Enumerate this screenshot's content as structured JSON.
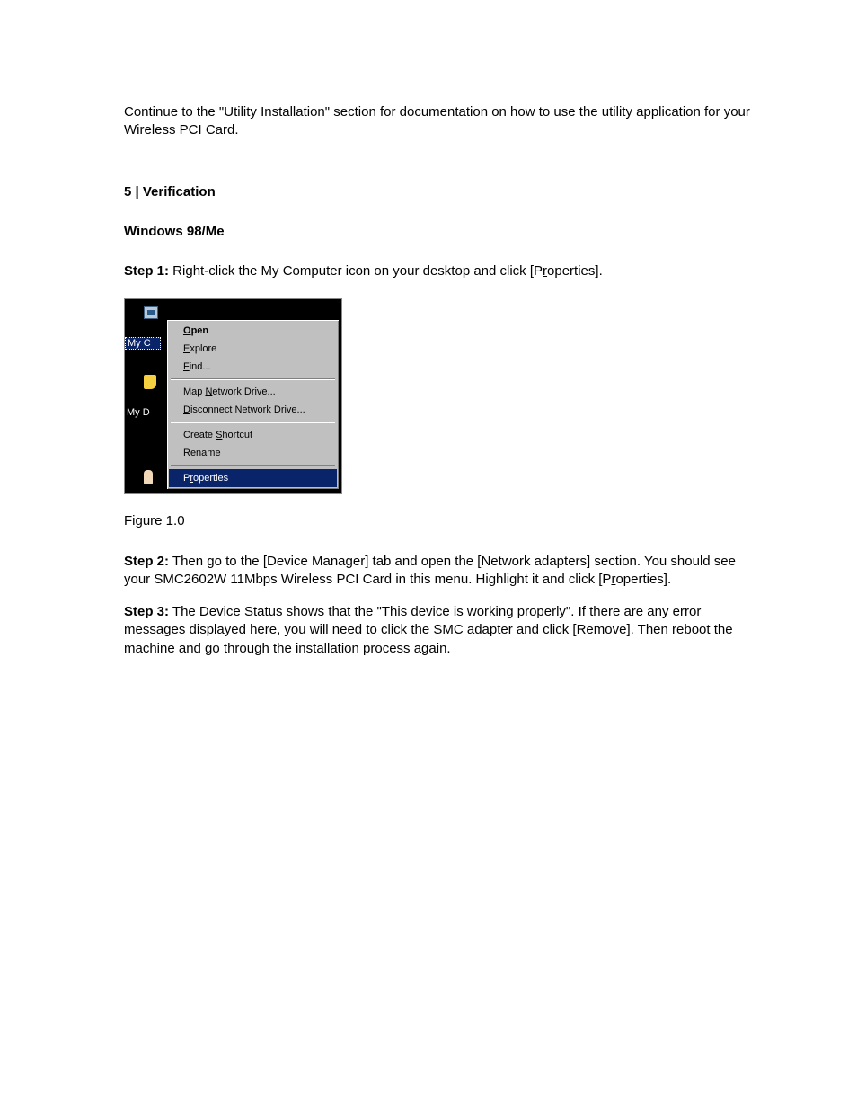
{
  "intro": "Continue to the \"Utility Installation\" section for documentation on how to use the utility application for your Wireless PCI Card.",
  "section_heading": "5 | Verification",
  "subheading": "Windows 98/Me",
  "step1": {
    "label": "Step 1:",
    "pre": " Right-click the My Computer icon on your desktop and click [P",
    "u": "r",
    "post": "operties]."
  },
  "figure": {
    "desktop": {
      "label_myc": "My C",
      "label_myd": "My D"
    },
    "menu": {
      "open": "pen",
      "open_u": "O",
      "explore_u": "E",
      "explore": "xplore",
      "find_u": "F",
      "find": "ind...",
      "map_pre": "Map ",
      "map_u": "N",
      "map_post": "etwork Drive...",
      "disc_u": "D",
      "disc": "isconnect Network Drive...",
      "shortcut_pre": "Create ",
      "shortcut_u": "S",
      "shortcut_post": "hortcut",
      "rename_pre": "Rena",
      "rename_u": "m",
      "rename_post": "e",
      "props_pre": "P",
      "props_u": "r",
      "props_post": "operties"
    },
    "caption": "Figure 1.0"
  },
  "step2": {
    "label": "Step 2:",
    "pre": " Then go to the [Device Manager] tab and open the [Network adapters] section. You should see your SMC2602W 11Mbps Wireless PCI Card in this menu. Highlight it and click [P",
    "u": "r",
    "post": "operties]."
  },
  "step3": {
    "label": "Step 3:",
    "text": " The Device Status shows that the \"This device is working properly\". If there are any error messages displayed here, you will need to click the SMC adapter and click [Remove]. Then reboot the machine and go through the installation process again."
  }
}
